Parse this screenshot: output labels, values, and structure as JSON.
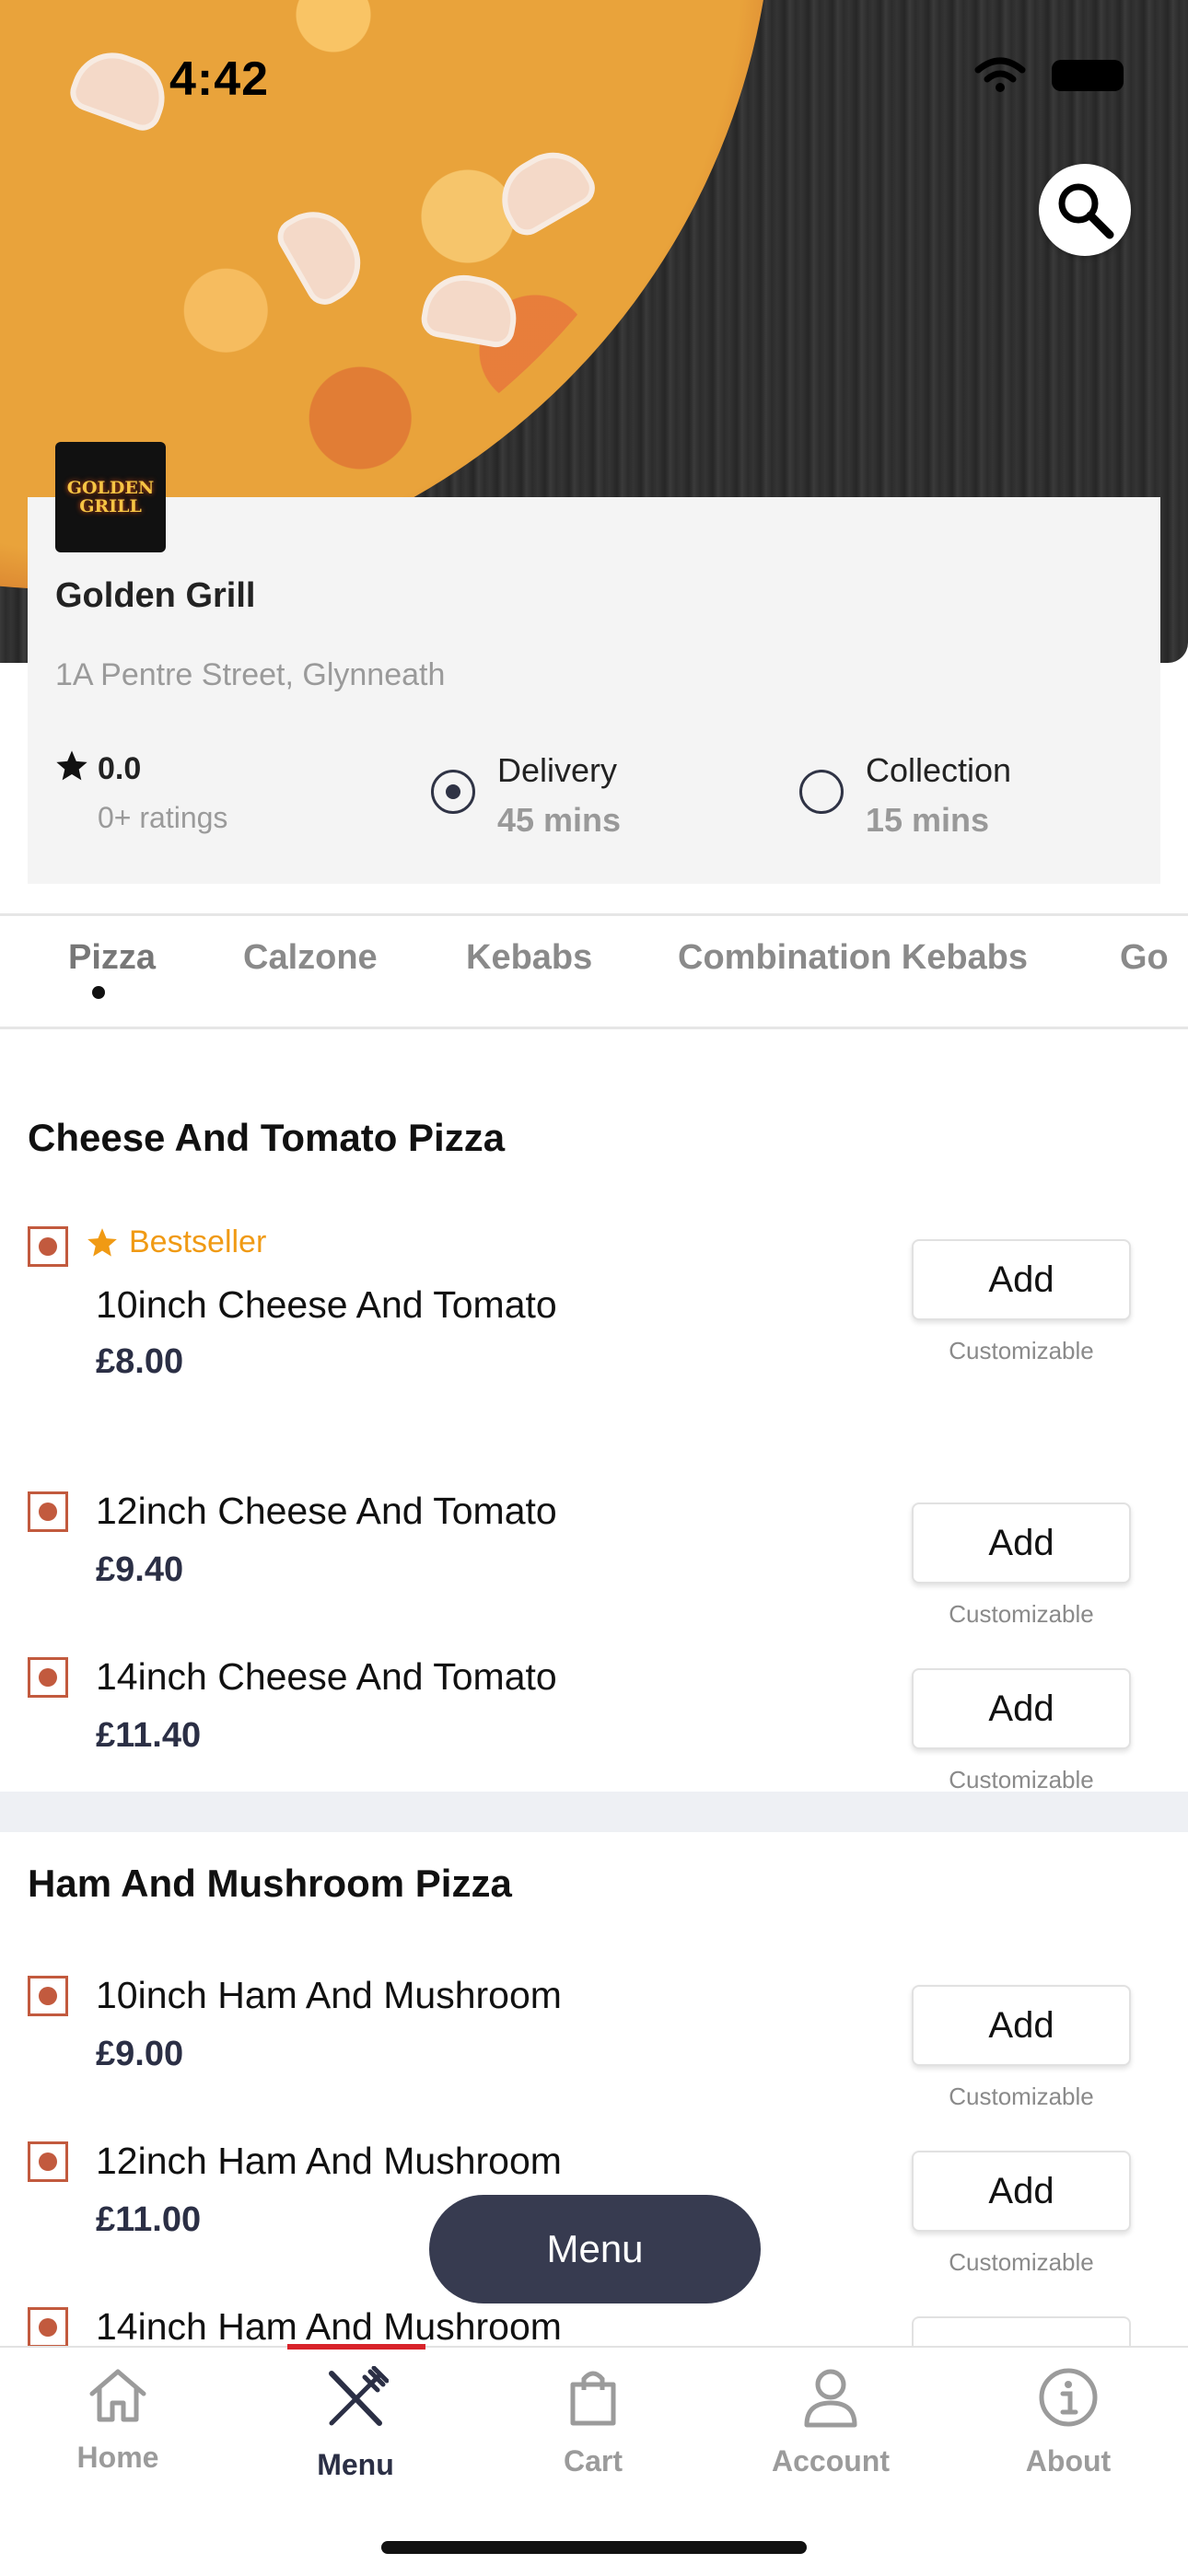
{
  "status": {
    "time": "4:42"
  },
  "restaurant": {
    "logo_text_line1": "GOLDEN",
    "logo_text_line2": "GRILL",
    "name": "Golden Grill",
    "address": "1A Pentre Street, Glynneath",
    "rating": "0.0",
    "ratings_count": "0+ ratings"
  },
  "fulfillment": {
    "selected": "delivery",
    "delivery": {
      "label": "Delivery",
      "time": "45 mins"
    },
    "collection": {
      "label": "Collection",
      "time": "15 mins"
    }
  },
  "categories": [
    "Pizza",
    "Calzone",
    "Kebabs",
    "Combination Kebabs",
    "Go"
  ],
  "sections": [
    {
      "title": "Cheese And Tomato Pizza",
      "items": [
        {
          "badge": "Bestseller",
          "name": "10inch Cheese And Tomato",
          "price": "£8.00",
          "button": "Add",
          "note": "Customizable"
        },
        {
          "name": "12inch Cheese And Tomato",
          "price": "£9.40",
          "button": "Add",
          "note": "Customizable"
        },
        {
          "name": "14inch Cheese And Tomato",
          "price": "£11.40",
          "button": "Add",
          "note": "Customizable"
        }
      ]
    },
    {
      "title": "Ham And Mushroom Pizza",
      "items": [
        {
          "name": "10inch Ham And Mushroom",
          "price": "£9.00",
          "button": "Add",
          "note": "Customizable"
        },
        {
          "name": "12inch Ham And Mushroom",
          "price": "£11.00",
          "button": "Add",
          "note": "Customizable"
        },
        {
          "name": "14inch Ham And Mushroom"
        }
      ]
    }
  ],
  "floating_menu": "Menu",
  "tabbar": [
    {
      "label": "Home",
      "icon": "home-icon"
    },
    {
      "label": "Menu",
      "icon": "cutlery-icon",
      "active": true
    },
    {
      "label": "Cart",
      "icon": "bag-icon"
    },
    {
      "label": "Account",
      "icon": "user-icon"
    },
    {
      "label": "About",
      "icon": "info-icon"
    }
  ],
  "colors": {
    "accent": "#d8232a",
    "dark": "#373b50",
    "veg": "#c25a3e",
    "bestseller": "#f09a14"
  }
}
